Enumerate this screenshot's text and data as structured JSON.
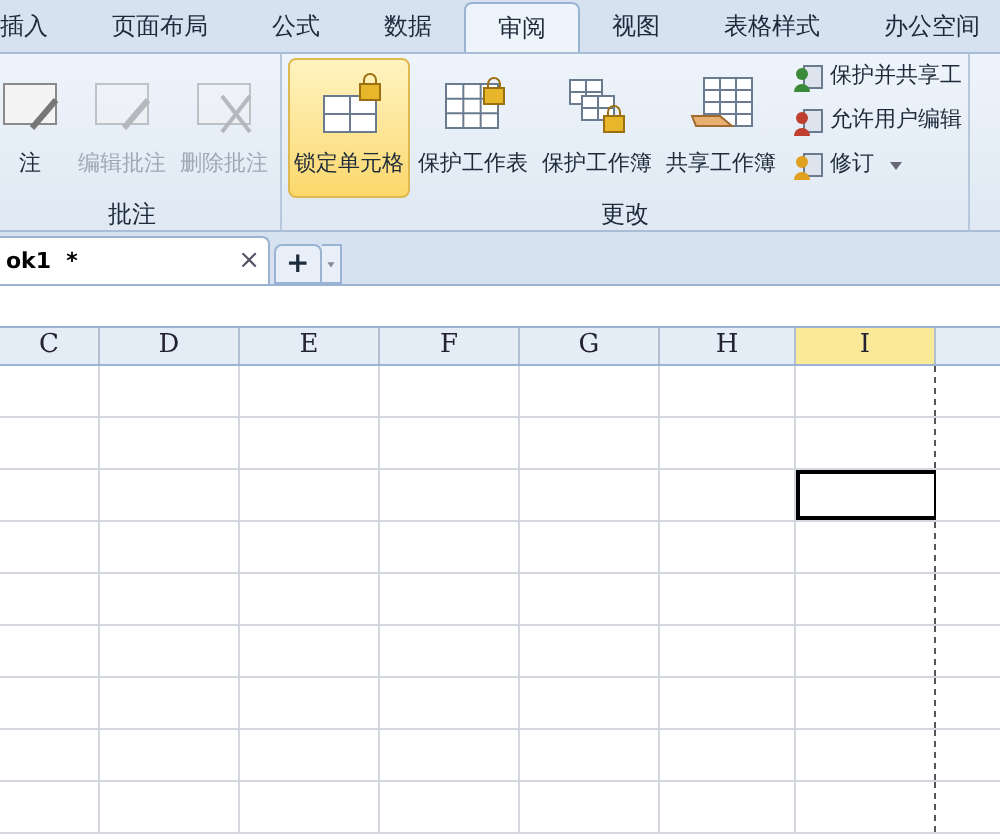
{
  "menu_tabs": [
    {
      "label": "插入",
      "selected": false
    },
    {
      "label": "页面布局",
      "selected": false
    },
    {
      "label": "公式",
      "selected": false
    },
    {
      "label": "数据",
      "selected": false
    },
    {
      "label": "审阅",
      "selected": true
    },
    {
      "label": "视图",
      "selected": false
    },
    {
      "label": "表格样式",
      "selected": false
    },
    {
      "label": "办公空间",
      "selected": false
    }
  ],
  "ribbon_groups": [
    {
      "title": "批注",
      "buttons": [
        {
          "label": "注",
          "kind": "new-comment",
          "disabled": false,
          "selected": false
        },
        {
          "label": "编辑批注",
          "kind": "edit-comment",
          "disabled": true,
          "selected": false
        },
        {
          "label": "删除批注",
          "kind": "delete-comment",
          "disabled": true,
          "selected": false
        }
      ]
    },
    {
      "title": "更改",
      "buttons": [
        {
          "label": "锁定单元格",
          "kind": "lock-cell",
          "disabled": false,
          "selected": true
        },
        {
          "label": "保护工作表",
          "kind": "protect-sheet",
          "disabled": false,
          "selected": false
        },
        {
          "label": "保护工作簿",
          "kind": "protect-book",
          "disabled": false,
          "selected": false
        },
        {
          "label": "共享工作簿",
          "kind": "share-book",
          "disabled": false,
          "selected": false
        }
      ],
      "small_buttons": [
        {
          "label": "保护并共享工",
          "kind": "protect-share",
          "dropdown": false
        },
        {
          "label": "允许用户编辑",
          "kind": "allow-edit",
          "dropdown": false
        },
        {
          "label": "修订",
          "kind": "track",
          "dropdown": true
        }
      ]
    }
  ],
  "document_tab": {
    "title": "ok1  *",
    "close": "×",
    "new_tab": "+"
  },
  "sheet": {
    "columns": [
      {
        "label": "C",
        "selected": false
      },
      {
        "label": "D",
        "selected": false
      },
      {
        "label": "E",
        "selected": false
      },
      {
        "label": "F",
        "selected": false
      },
      {
        "label": "G",
        "selected": false
      },
      {
        "label": "H",
        "selected": false
      },
      {
        "label": "I",
        "selected": true
      }
    ],
    "rows": [
      {
        "active": false
      },
      {
        "active": false
      },
      {
        "active": true
      },
      {
        "active": false
      },
      {
        "active": false
      },
      {
        "active": false
      },
      {
        "active": false
      },
      {
        "active": false
      },
      {
        "active": false
      }
    ]
  }
}
